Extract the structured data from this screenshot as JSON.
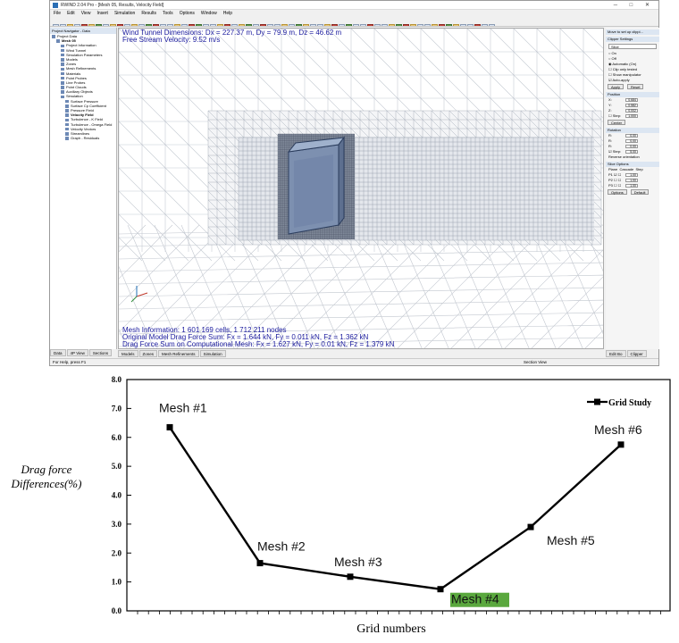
{
  "app": {
    "title": "RWIND 2.04 Pro - [Mesh 05, Results, Velocity Field]",
    "window_buttons": "─ □ ✕",
    "menu": [
      "File",
      "Edit",
      "View",
      "Insert",
      "Simulation",
      "Results",
      "Tools",
      "Options",
      "Window",
      "Help"
    ]
  },
  "navigator": {
    "header": "Project Navigator - Data",
    "items": [
      {
        "label": "Project Data",
        "depth": 0
      },
      {
        "label": "Mesh 05",
        "depth": 1,
        "bold": true
      },
      {
        "label": "Project Information",
        "depth": 2
      },
      {
        "label": "Wind Tunnel",
        "depth": 2
      },
      {
        "label": "Simulation Parameters",
        "depth": 2
      },
      {
        "label": "Models",
        "depth": 2
      },
      {
        "label": "Zones",
        "depth": 2
      },
      {
        "label": "Mesh Refinements",
        "depth": 2
      },
      {
        "label": "Materials",
        "depth": 2
      },
      {
        "label": "Point Probes",
        "depth": 2
      },
      {
        "label": "Line Probes",
        "depth": 2
      },
      {
        "label": "Point Clouds",
        "depth": 2
      },
      {
        "label": "Auxiliary Objects",
        "depth": 2
      },
      {
        "label": "Simulation",
        "depth": 2
      },
      {
        "label": "Surface Pressure",
        "depth": 3
      },
      {
        "label": "Surface Cp Coefficient",
        "depth": 3
      },
      {
        "label": "Pressure Field",
        "depth": 3
      },
      {
        "label": "Velocity Field",
        "depth": 3,
        "bold": true
      },
      {
        "label": "Turbulence - K Field",
        "depth": 3
      },
      {
        "label": "Turbulence - Omega Field",
        "depth": 3
      },
      {
        "label": "Velocity Vectors",
        "depth": 3
      },
      {
        "label": "Streamlines",
        "depth": 3
      },
      {
        "label": "Graph - Residuals",
        "depth": 3
      }
    ],
    "tabs": [
      "Data",
      "4P View",
      "Sections"
    ]
  },
  "viewport": {
    "top_line_1": "Wind Tunnel Dimensions: Dx = 227.37 m, Dy = 79.9 m, Dz = 46.62 m",
    "top_line_2": "Free Stream Velocity: 9.52 m/s",
    "bottom_line_1": "Mesh Information: 1 601 169 cells, 1 712 211 nodes",
    "bottom_line_2": "Original Model Drag Force Sum: Fx = 1.644 kN, Fy = 0.011 kN, Fz = 1.362 kN",
    "bottom_line_3": "Drag Force Sum on Computational Mesh: Fx = 1.627 kN, Fy = 0.01 kN, Fz = 1.379 kN",
    "tabs": [
      "Models",
      "Zones",
      "Mesh Refinements",
      "Simulation"
    ],
    "right_tabs": [
      "Edit Bo",
      "Clipper"
    ]
  },
  "right_panel": {
    "header": "Move to set up clippi...",
    "section1": "Clipper Settings",
    "selector": "Slice",
    "options": [
      "On",
      "Off",
      "Automatic (On)"
    ],
    "checks": [
      "Clip only tested",
      "Show manipulator",
      "Auto-apply"
    ],
    "apply": "Apply",
    "reset": "Reset",
    "section2": "Position",
    "x": "0.684",
    "y": "0.582",
    "z": "0.002",
    "step": "Step:",
    "step_val": "1.000",
    "center": "Center",
    "section3": "Rotation",
    "rx": "0.00",
    "ry": "0.00",
    "rz": "0.00",
    "step2_val": "5.00",
    "reverse": "Reverse orientation",
    "section4": "Slice Options",
    "slice_cols": [
      "Plane",
      "Cascade",
      "Step"
    ],
    "slice_rows": [
      "P1",
      "P2",
      "P3"
    ],
    "slice_val": "1.00",
    "options_btn": "Options",
    "default_btn": "Default"
  },
  "status": {
    "left": "For Help, press F1",
    "mid": "Section View"
  },
  "chart_data": {
    "type": "line",
    "categories": [
      "Mesh #1",
      "Mesh #2",
      "Mesh #3",
      "Mesh #4",
      "Mesh #5",
      "Mesh #6"
    ],
    "series": [
      {
        "name": "Grid Study",
        "values": [
          6.35,
          1.65,
          1.18,
          0.75,
          2.9,
          5.75
        ]
      }
    ],
    "point_labels": [
      "Mesh #1",
      "Mesh #2",
      "Mesh #3",
      "Mesh #4",
      "Mesh #5",
      "Mesh #6"
    ],
    "highlight_index": 3,
    "highlight_color": "#5aa83e",
    "xlabel": "Grid numbers",
    "ylabel_line1": "Drag force",
    "ylabel_line2": "Differences(%)",
    "ylim": [
      0,
      8
    ],
    "yticks": [
      "0.0",
      "1.0",
      "2.0",
      "3.0",
      "4.0",
      "5.0",
      "6.0",
      "7.0",
      "8.0"
    ],
    "legend_position": "top-right",
    "grid": false
  }
}
